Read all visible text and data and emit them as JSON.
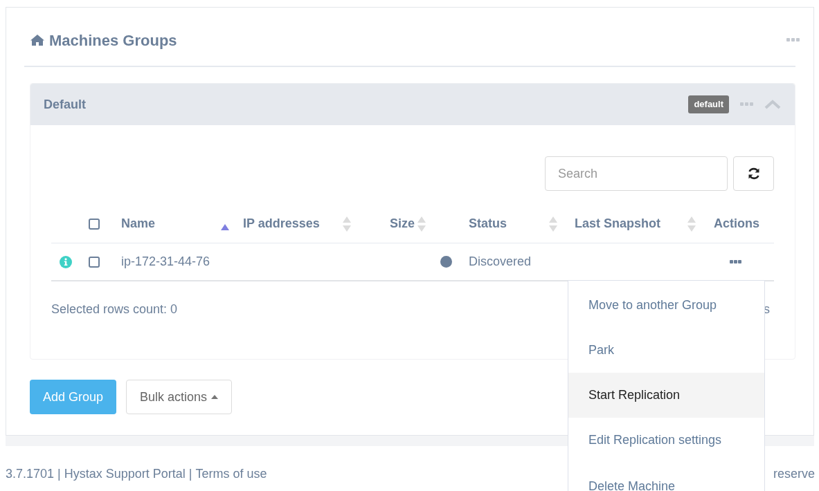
{
  "page": {
    "title": "Machines Groups"
  },
  "group": {
    "name": "Default",
    "badge": "default",
    "expanded": true,
    "search": {
      "placeholder": "Search"
    },
    "table": {
      "select_all": {
        "checked": false
      },
      "columns": [
        {
          "label": "Name",
          "sorted": true
        },
        {
          "label": "IP addresses",
          "sorted": false
        },
        {
          "label": "Size",
          "sorted": false
        },
        {
          "label": "Status",
          "sorted": false
        },
        {
          "label": "Last Snapshot",
          "sorted": false
        },
        {
          "label": "Actions"
        }
      ],
      "rows": [
        {
          "name": "ip-172-31-44-76",
          "checked": false,
          "status": "Discovered",
          "color": "#6b7f99"
        }
      ]
    },
    "selected_count": "Selected rows count: 0",
    "partial_text": "s"
  },
  "buttons": [
    {
      "label": "Add Group",
      "kind": "primary"
    },
    {
      "label": "Bulk actions",
      "kind": "dropdown"
    }
  ],
  "menu": {
    "items": [
      {
        "label": "Move to another Group",
        "selected": false
      },
      {
        "label": "Park",
        "selected": false
      },
      {
        "label": "Start Replication",
        "selected": true
      },
      {
        "label": "Edit Replication settings",
        "selected": false
      },
      {
        "label": "Delete Machine",
        "selected": false
      }
    ]
  },
  "footer": {
    "version": "3.7.1701",
    "separator": "|",
    "links": [
      "Hystax Support Portal",
      "Terms of use"
    ],
    "right_text": "reserve"
  }
}
